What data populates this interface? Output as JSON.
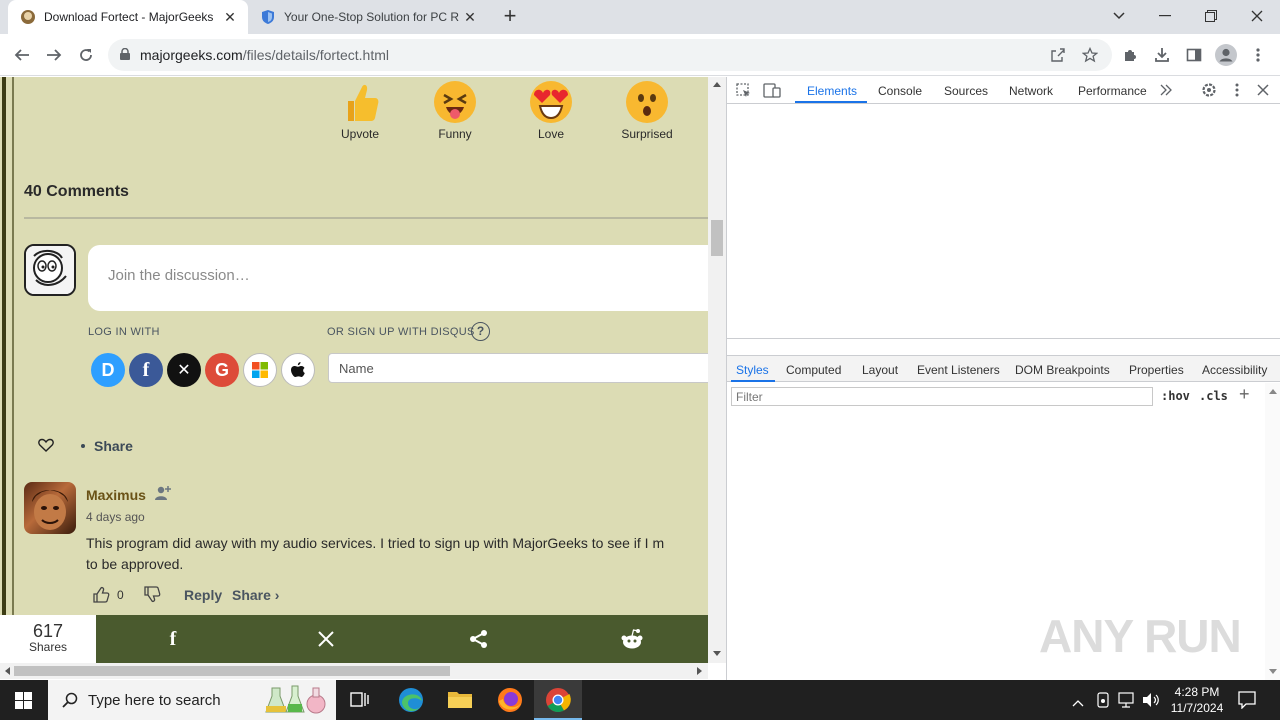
{
  "browser": {
    "tabs": [
      {
        "title": "Download Fortect - MajorGeeks",
        "active": true
      },
      {
        "title": "Your One-Stop Solution for PC R",
        "active": false
      }
    ],
    "new_tab": "+",
    "url_host": "majorgeeks.com",
    "url_path": "/files/details/fortect.html"
  },
  "reactions": [
    {
      "label": "Upvote"
    },
    {
      "label": "Funny"
    },
    {
      "label": "Love"
    },
    {
      "label": "Surprised"
    }
  ],
  "comments": {
    "count_label": "40 Comments",
    "placeholder": "Join the discussion…",
    "login_with": "LOG IN WITH",
    "signup_with": "OR SIGN UP WITH DISQUS",
    "help": "?",
    "name_placeholder": "Name",
    "share_label": "Share",
    "first": {
      "author": "Maximus",
      "posted": "4 days ago",
      "text_line1": "This program did away with my audio services. I tried to sign up with MajorGeeks to see if I m",
      "text_line2": "to be approved.",
      "upvotes": "0",
      "reply": "Reply",
      "share": "Share ›"
    }
  },
  "sharebar": {
    "count": "617",
    "count_label": "Shares"
  },
  "devtools": {
    "tabs": [
      "Elements",
      "Console",
      "Sources",
      "Network",
      "Performance"
    ],
    "more": ">>",
    "styles_tabs": [
      "Styles",
      "Computed",
      "Layout",
      "Event Listeners",
      "DOM Breakpoints",
      "Properties",
      "Accessibility"
    ],
    "filter_placeholder": "Filter",
    "hov": ":hov",
    "cls": ".cls",
    "plus": "+"
  },
  "watermark": "ANY RUN",
  "taskbar": {
    "search_placeholder": "Type here to search",
    "time": "4:28 PM",
    "date": "11/7/2024"
  },
  "colors": {
    "page_bg": "#dcdcb4",
    "sharebar_bg": "#4a5a2e",
    "devtools_accent": "#1a73e8",
    "author": "#6a5216"
  }
}
